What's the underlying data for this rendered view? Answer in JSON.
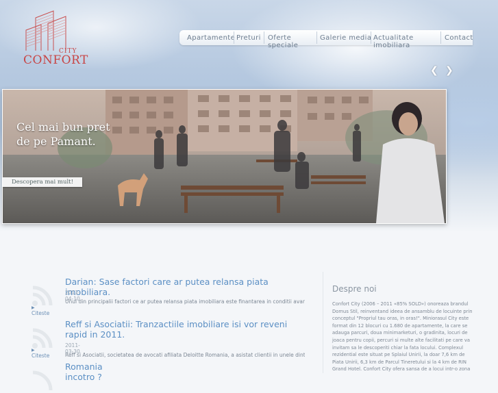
{
  "logo": {
    "city": "CITY",
    "confort": "CONFORT"
  },
  "nav": {
    "items": [
      {
        "label": "Apartamente"
      },
      {
        "label": "Preturi"
      },
      {
        "label": "Oferte speciale"
      },
      {
        "label": "Galerie media"
      },
      {
        "label": "Actualitate imobiliara"
      },
      {
        "label": "Contact"
      }
    ]
  },
  "slider": {
    "prev_icon": "chevron-left-icon",
    "next_icon": "chevron-right-icon"
  },
  "hero": {
    "caption": "Cel mai bun pret de pe Pamant.",
    "button_label": "Descopera mai mult!"
  },
  "news": [
    {
      "title": "Darian: Sase factori care ar putea relansa piata imobiliara.",
      "date": "2011-04-10",
      "excerpt": "Unul din principalii factori ce ar putea relansa piata imobiliara este finantarea in conditii avantajoase ...",
      "read_label": "Citeste"
    },
    {
      "title": "Reff si Asociatii: Tranzactiile imobiliare isi vor reveni rapid in 2011.",
      "date": "2011-03-30",
      "excerpt": "Reff si Asociatii, societatea de avocati afiliata Deloitte Romania, a asistat clientii in unele dintre...",
      "read_label": "Citeste"
    },
    {
      "title": "Romania incotro ?",
      "date": "",
      "excerpt": "",
      "read_label": ""
    }
  ],
  "about": {
    "title": "Despre noi",
    "text": "Confort City (2006 – 2011 «85% SOLD») onoreaza brandul Domus Stil, reinventand ideea de ansamblu de locuinte prin conceptul \"Propriul tau oras, in oras!\". Miniorasul City este format din 12 blocuri cu 1.680 de apartamente, la care se adauga parcuri, doua minimarketuri, o gradinita, locuri de joaca pentru copii, percuri si multe alte facilitati pe care va invitam sa le descoperiti chiar la fata locului. Complexul rezidential este situat pe Splaiul Unirii, la doar 7,6 km de Piata Unirii, 6,3 km de Parcul Tineretului si la 4 km de RIN Grand Hotel. Confort City ofera sansa de a locui intr-o zona"
  }
}
